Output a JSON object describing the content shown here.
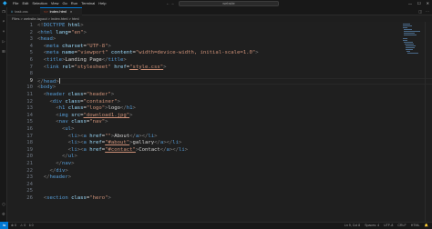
{
  "titlebar": {
    "menu": [
      "File",
      "Edit",
      "Selection",
      "View",
      "Go",
      "Run",
      "Terminal",
      "Help"
    ],
    "search": "website"
  },
  "tabs": [
    {
      "label": "task.css",
      "active": false
    },
    {
      "label": "index.html",
      "active": true,
      "close": "×"
    }
  ],
  "breadcrumb": "Files > website-layout > index.html > html",
  "editor": {
    "current_line": 9,
    "lines": [
      [
        [
          "<!",
          "t-brk"
        ],
        [
          "DOCTYPE",
          "t-tag"
        ],
        [
          " ",
          "t-txt"
        ],
        [
          "html",
          "t-attr"
        ],
        [
          ">",
          "t-brk"
        ]
      ],
      [
        [
          "<",
          "t-brk"
        ],
        [
          "html",
          "t-tag"
        ],
        [
          " ",
          "t-txt"
        ],
        [
          "lang",
          "t-attr"
        ],
        [
          "=",
          "t-txt"
        ],
        [
          "\"en\"",
          "t-str"
        ],
        [
          ">",
          "t-brk"
        ]
      ],
      [
        [
          "<",
          "t-brk"
        ],
        [
          "head",
          "t-tag"
        ],
        [
          ">",
          "t-brk"
        ]
      ],
      [
        [
          "  <",
          "t-brk"
        ],
        [
          "meta",
          "t-tag"
        ],
        [
          " ",
          "t-txt"
        ],
        [
          "charset",
          "t-attr"
        ],
        [
          "=",
          "t-txt"
        ],
        [
          "\"UTF-8\"",
          "t-str"
        ],
        [
          ">",
          "t-brk"
        ]
      ],
      [
        [
          "  <",
          "t-brk"
        ],
        [
          "meta",
          "t-tag"
        ],
        [
          " ",
          "t-txt"
        ],
        [
          "name",
          "t-attr"
        ],
        [
          "=",
          "t-txt"
        ],
        [
          "\"viewport\"",
          "t-str"
        ],
        [
          " ",
          "t-txt"
        ],
        [
          "content",
          "t-attr"
        ],
        [
          "=",
          "t-txt"
        ],
        [
          "\"width=device-width, initial-scale=1.0\"",
          "t-str"
        ],
        [
          ">",
          "t-brk"
        ]
      ],
      [
        [
          "  <",
          "t-brk"
        ],
        [
          "title",
          "t-tag"
        ],
        [
          ">",
          "t-brk"
        ],
        [
          "Landing Page",
          "t-txt"
        ],
        [
          "</",
          "t-brk"
        ],
        [
          "title",
          "t-tag"
        ],
        [
          ">",
          "t-brk"
        ]
      ],
      [
        [
          "  <",
          "t-brk"
        ],
        [
          "link",
          "t-tag"
        ],
        [
          " ",
          "t-txt"
        ],
        [
          "rel",
          "t-attr"
        ],
        [
          "=",
          "t-txt"
        ],
        [
          "\"stylesheet\"",
          "t-str"
        ],
        [
          " ",
          "t-txt"
        ],
        [
          "href",
          "t-attr"
        ],
        [
          "=",
          "t-txt"
        ],
        [
          "\"style.css\"",
          "t-str und"
        ],
        [
          ">",
          "t-brk"
        ]
      ],
      [],
      [
        [
          "</",
          "t-brk"
        ],
        [
          "head",
          "t-tag"
        ],
        [
          ">",
          "t-brk"
        ]
      ],
      [
        [
          "<",
          "t-brk"
        ],
        [
          "body",
          "t-tag"
        ],
        [
          ">",
          "t-brk"
        ]
      ],
      [
        [
          "  <",
          "t-brk"
        ],
        [
          "header",
          "t-tag"
        ],
        [
          " ",
          "t-txt"
        ],
        [
          "class",
          "t-attr"
        ],
        [
          "=",
          "t-txt"
        ],
        [
          "\"header\"",
          "t-str"
        ],
        [
          ">",
          "t-brk"
        ]
      ],
      [
        [
          "    <",
          "t-brk"
        ],
        [
          "div",
          "t-tag"
        ],
        [
          " ",
          "t-txt"
        ],
        [
          "class",
          "t-attr"
        ],
        [
          "=",
          "t-txt"
        ],
        [
          "\"container\"",
          "t-str"
        ],
        [
          ">",
          "t-brk"
        ]
      ],
      [
        [
          "      <",
          "t-brk"
        ],
        [
          "h1",
          "t-tag"
        ],
        [
          " ",
          "t-txt"
        ],
        [
          "class",
          "t-attr"
        ],
        [
          "=",
          "t-txt"
        ],
        [
          "\"logo\"",
          "t-str"
        ],
        [
          ">",
          "t-brk"
        ],
        [
          "logo",
          "t-txt"
        ],
        [
          "</",
          "t-brk"
        ],
        [
          "h1",
          "t-tag"
        ],
        [
          ">",
          "t-brk"
        ]
      ],
      [
        [
          "      <",
          "t-brk"
        ],
        [
          "img",
          "t-tag"
        ],
        [
          " ",
          "t-txt"
        ],
        [
          "src",
          "t-attr"
        ],
        [
          "=",
          "t-txt"
        ],
        [
          "\"download1.jpg\"",
          "t-str und"
        ],
        [
          ">",
          "t-brk"
        ]
      ],
      [
        [
          "      <",
          "t-brk"
        ],
        [
          "nav",
          "t-tag"
        ],
        [
          " ",
          "t-txt"
        ],
        [
          "class",
          "t-attr"
        ],
        [
          "=",
          "t-txt"
        ],
        [
          "\"nav\"",
          "t-str"
        ],
        [
          ">",
          "t-brk"
        ]
      ],
      [
        [
          "        <",
          "t-brk"
        ],
        [
          "ul",
          "t-tag"
        ],
        [
          ">",
          "t-brk"
        ]
      ],
      [
        [
          "          <",
          "t-brk"
        ],
        [
          "li",
          "t-tag"
        ],
        [
          "><",
          "t-brk"
        ],
        [
          "a",
          "t-tag"
        ],
        [
          " ",
          "t-txt"
        ],
        [
          "href",
          "t-attr"
        ],
        [
          "=",
          "t-txt"
        ],
        [
          "\"\"",
          "t-str"
        ],
        [
          ">",
          "t-brk"
        ],
        [
          "About",
          "t-txt"
        ],
        [
          "</",
          "t-brk"
        ],
        [
          "a",
          "t-tag"
        ],
        [
          "></",
          "t-brk"
        ],
        [
          "li",
          "t-tag"
        ],
        [
          ">",
          "t-brk"
        ]
      ],
      [
        [
          "          <",
          "t-brk"
        ],
        [
          "li",
          "t-tag"
        ],
        [
          "><",
          "t-brk"
        ],
        [
          "a",
          "t-tag"
        ],
        [
          " ",
          "t-txt"
        ],
        [
          "href",
          "t-attr"
        ],
        [
          "=",
          "t-txt"
        ],
        [
          "\"#about\"",
          "t-str und"
        ],
        [
          ">",
          "t-brk"
        ],
        [
          "gallary",
          "t-txt"
        ],
        [
          "</",
          "t-brk"
        ],
        [
          "a",
          "t-tag"
        ],
        [
          "></",
          "t-brk"
        ],
        [
          "li",
          "t-tag"
        ],
        [
          ">",
          "t-brk"
        ]
      ],
      [
        [
          "          <",
          "t-brk"
        ],
        [
          "li",
          "t-tag"
        ],
        [
          "><",
          "t-brk"
        ],
        [
          "a",
          "t-tag"
        ],
        [
          " ",
          "t-txt"
        ],
        [
          "href",
          "t-attr"
        ],
        [
          "=",
          "t-txt"
        ],
        [
          "\"#contact\"",
          "t-str und"
        ],
        [
          ">",
          "t-brk"
        ],
        [
          "Contact",
          "t-txt"
        ],
        [
          "</",
          "t-brk"
        ],
        [
          "a",
          "t-tag"
        ],
        [
          "></",
          "t-brk"
        ],
        [
          "li",
          "t-tag"
        ],
        [
          ">",
          "t-brk"
        ]
      ],
      [
        [
          "        </",
          "t-brk"
        ],
        [
          "ul",
          "t-tag"
        ],
        [
          ">",
          "t-brk"
        ]
      ],
      [
        [
          "      </",
          "t-brk"
        ],
        [
          "nav",
          "t-tag"
        ],
        [
          ">",
          "t-brk"
        ]
      ],
      [
        [
          "    </",
          "t-brk"
        ],
        [
          "div",
          "t-tag"
        ],
        [
          ">",
          "t-brk"
        ]
      ],
      [
        [
          "  </",
          "t-brk"
        ],
        [
          "header",
          "t-tag"
        ],
        [
          ">",
          "t-brk"
        ]
      ],
      [],
      [],
      [
        [
          "  <",
          "t-brk"
        ],
        [
          "section",
          "t-tag"
        ],
        [
          " ",
          "t-txt"
        ],
        [
          "class",
          "t-attr"
        ],
        [
          "=",
          "t-txt"
        ],
        [
          "\"hero\"",
          "t-str"
        ],
        [
          ">",
          "t-brk"
        ]
      ]
    ]
  },
  "statusbar": {
    "left": [
      "⊗ 0",
      "⚠ 0",
      "ℹ 0"
    ],
    "right": [
      "Ln 9, Col 8",
      "Spaces: 4",
      "UTF-8",
      "CRLF",
      "HTML",
      "🔔"
    ]
  },
  "colors": {
    "accent": "#0078d4",
    "background": "#1e1e1e"
  }
}
